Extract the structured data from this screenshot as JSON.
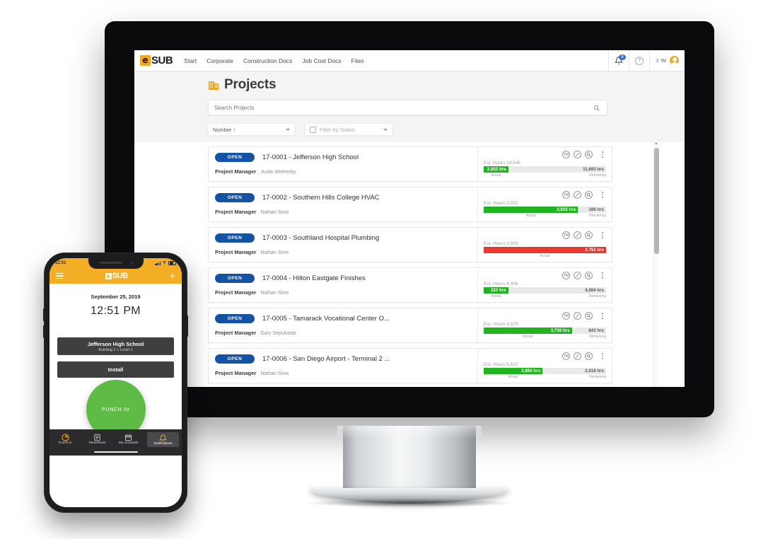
{
  "desktop": {
    "navbar": {
      "logo_e": "e",
      "logo_text": "SUB",
      "links": [
        "Start",
        "Corporate",
        "Construction Docs",
        "Job Cost Docs",
        "Files"
      ],
      "notification_count": "0",
      "help_label": "?",
      "user_initials": "J W"
    },
    "page": {
      "title": "Projects",
      "search_placeholder": "Search Projects",
      "sort_label": "Number ↑",
      "status_filter_label": "Filter by Status"
    },
    "projects": [
      {
        "status": "OPEN",
        "name": "17-0001 - Jefferson High School",
        "pm_label": "Project Manager",
        "pm_name": "Justin Wetherby",
        "est_hours_label": "Est. Hours 14,545",
        "actual": "2,852 hrs",
        "remaining": "11,693 hrs",
        "actual_caption": "Actual",
        "remaining_caption": "Remaining",
        "actual_pct": 20,
        "over_budget": false
      },
      {
        "status": "OPEN",
        "name": "17-0002 - Southern Hills College HVAC",
        "pm_label": "Project Manager",
        "pm_name": "Nathan Sims",
        "est_hours_label": "Est. Hours 3,021",
        "actual": "2,832 hrs",
        "remaining": "189 hrs",
        "actual_caption": "Actual",
        "remaining_caption": "Remaining",
        "actual_pct": 77,
        "over_budget": false
      },
      {
        "status": "OPEN",
        "name": "17-0003 - Southland Hospital Plumbing",
        "pm_label": "Project Manager",
        "pm_name": "Nathan Sims",
        "est_hours_label": "Est. Hours 3,503",
        "actual": "3,751 hrs",
        "remaining": "",
        "actual_caption": "Actual",
        "remaining_caption": "",
        "actual_pct": 100,
        "over_budget": true
      },
      {
        "status": "OPEN",
        "name": "17-0004 - Hilton Eastgate Finishes",
        "pm_label": "Project Manager",
        "pm_name": "Nathan Sims",
        "est_hours_label": "Est. Hours 4,406",
        "actual": "322 hrs",
        "remaining": "4,084 hrs",
        "actual_caption": "Actual",
        "remaining_caption": "Remaining",
        "actual_pct": 20,
        "over_budget": false
      },
      {
        "status": "OPEN",
        "name": "17-0005 - Tamarack Vocational Center O...",
        "pm_label": "Project Manager",
        "pm_name": "Gary Sepulveda",
        "est_hours_label": "Est. Hours 4,579",
        "actual": "3,736 hrs",
        "remaining": "843 hrs",
        "actual_caption": "Actual",
        "remaining_caption": "Remaining",
        "actual_pct": 72,
        "over_budget": false
      },
      {
        "status": "OPEN",
        "name": "17-0006 - San Diego Airport - Terminal 2 ...",
        "pm_label": "Project Manager",
        "pm_name": "Nathan Sims",
        "est_hours_label": "Est. Hours 5,510",
        "actual": "2,892 hrs",
        "remaining": "2,618 hrs",
        "actual_caption": "Actual",
        "remaining_caption": "Remaining",
        "actual_pct": 48,
        "over_budget": false
      }
    ],
    "row_icons": [
      "tm-icon",
      "edit-pencil-icon",
      "search-magnifier-icon",
      "kebab-menu-icon"
    ],
    "colors": {
      "brand_yellow": "#F0A91E",
      "status_pill_blue": "#1352A5",
      "bar_green": "#22B320",
      "bar_red": "#E8382F"
    }
  },
  "phone": {
    "status_time": "12:51",
    "logo_e": "e",
    "logo_text": "SUB",
    "date": "September 25, 2019",
    "time": "12:51 PM",
    "project_button": {
      "title": "Jefferson High School",
      "subtitle": "Building 2 > Level 1"
    },
    "task_button": {
      "title": "Install"
    },
    "punch_button": "PUNCH IN",
    "tabs": [
      {
        "label": "Punch In",
        "icon": "clock-icon",
        "active": false
      },
      {
        "label": "Timesheets",
        "icon": "timesheet-icon",
        "active": false
      },
      {
        "label": "My Schedule",
        "icon": "calendar-icon",
        "active": false
      },
      {
        "label": "Notifications",
        "icon": "bell-icon",
        "active": true
      }
    ]
  }
}
